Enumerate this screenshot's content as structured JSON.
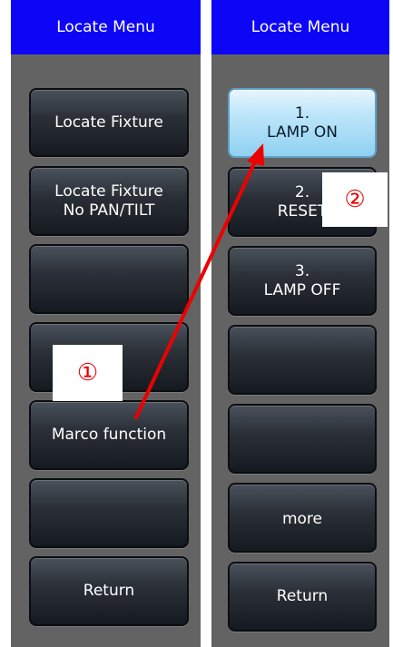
{
  "left_panel": {
    "title": "Locate Menu",
    "buttons": [
      {
        "label": "Locate Fixture"
      },
      {
        "label": "Locate Fixture\nNo PAN/TILT"
      },
      {
        "label": ""
      },
      {
        "label": ""
      },
      {
        "label": "Marco function"
      },
      {
        "label": ""
      },
      {
        "label": "Return"
      }
    ]
  },
  "right_panel": {
    "title": "Locate Menu",
    "buttons": [
      {
        "number": "1.",
        "label": "LAMP ON"
      },
      {
        "number": "2.",
        "label": "RESET"
      },
      {
        "number": "3.",
        "label": "LAMP OFF"
      },
      {
        "number": "",
        "label": ""
      },
      {
        "number": "",
        "label": ""
      },
      {
        "number": "",
        "label": "more"
      },
      {
        "number": "",
        "label": "Return"
      }
    ]
  },
  "annotations": {
    "step1": "①",
    "step2": "②",
    "arrow_color": "#ee0000"
  }
}
